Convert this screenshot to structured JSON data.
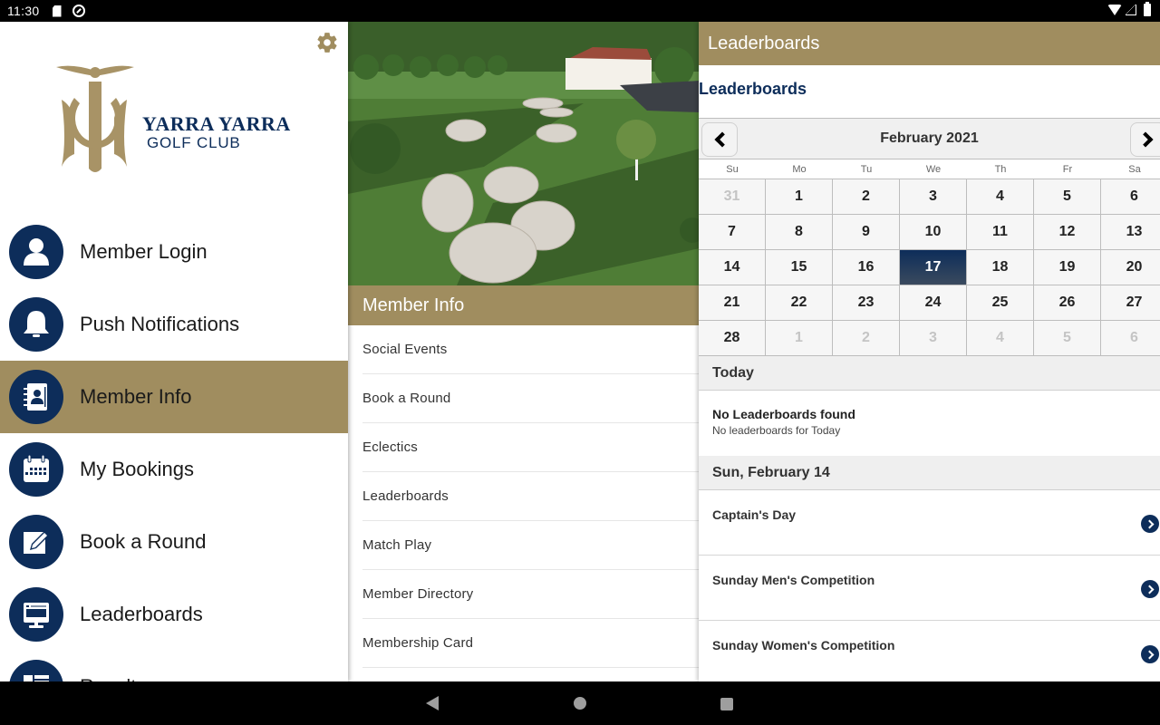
{
  "status_bar": {
    "time": "11:30"
  },
  "drawer": {
    "logo": {
      "line1": "Yarra Yarra",
      "line2": "GOLF CLUB"
    },
    "items": [
      {
        "label": "Member Login",
        "icon": "user-icon",
        "active": false
      },
      {
        "label": "Push Notifications",
        "icon": "bell-icon",
        "active": false
      },
      {
        "label": "Member Info",
        "icon": "contacts-book-icon",
        "active": true
      },
      {
        "label": "My Bookings",
        "icon": "calendar-icon",
        "active": false
      },
      {
        "label": "Book a Round",
        "icon": "edit-icon",
        "active": false
      },
      {
        "label": "Leaderboards",
        "icon": "monitor-icon",
        "active": false
      },
      {
        "label": "Results",
        "icon": "list-icon",
        "active": false
      }
    ]
  },
  "member_info": {
    "title": "Member Info",
    "items": [
      "Social Events",
      "Book a Round",
      "Eclectics",
      "Leaderboards",
      "Match Play",
      "Member Directory",
      "Membership Card"
    ]
  },
  "leaderboards": {
    "header": "Leaderboards",
    "title": "Leaderboards",
    "calendar": {
      "month_label": "February 2021",
      "weekdays": [
        "Su",
        "Mo",
        "Tu",
        "We",
        "Th",
        "Fr",
        "Sa"
      ],
      "days": [
        {
          "d": "31",
          "other": true
        },
        {
          "d": "1"
        },
        {
          "d": "2"
        },
        {
          "d": "3"
        },
        {
          "d": "4"
        },
        {
          "d": "5"
        },
        {
          "d": "6"
        },
        {
          "d": "7"
        },
        {
          "d": "8"
        },
        {
          "d": "9"
        },
        {
          "d": "10"
        },
        {
          "d": "11"
        },
        {
          "d": "12"
        },
        {
          "d": "13"
        },
        {
          "d": "14"
        },
        {
          "d": "15"
        },
        {
          "d": "16"
        },
        {
          "d": "17",
          "selected": true
        },
        {
          "d": "18"
        },
        {
          "d": "19"
        },
        {
          "d": "20"
        },
        {
          "d": "21"
        },
        {
          "d": "22"
        },
        {
          "d": "23"
        },
        {
          "d": "24"
        },
        {
          "d": "25"
        },
        {
          "d": "26"
        },
        {
          "d": "27"
        },
        {
          "d": "28"
        },
        {
          "d": "1",
          "other": true
        },
        {
          "d": "2",
          "other": true
        },
        {
          "d": "3",
          "other": true
        },
        {
          "d": "4",
          "other": true
        },
        {
          "d": "5",
          "other": true
        },
        {
          "d": "6",
          "other": true
        }
      ]
    },
    "today": {
      "heading": "Today",
      "empty_title": "No Leaderboards found",
      "empty_subtitle": "No leaderboards for Today"
    },
    "sections": [
      {
        "heading": "Sun, February 14",
        "items": [
          "Captain's Day",
          "Sunday Men's Competition",
          "Sunday Women's Competition"
        ]
      }
    ]
  },
  "colors": {
    "gold": "#a08d5f",
    "navy": "#0d2d5a"
  }
}
